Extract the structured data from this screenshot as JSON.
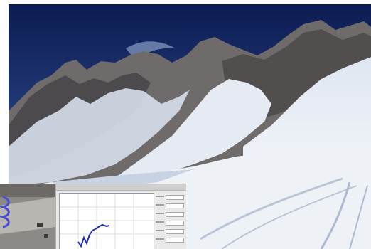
{
  "scene": {
    "description_visible_text": "",
    "colors": {
      "sky_top": "#0c1c52",
      "sky_bottom": "#3f5ea6",
      "rock_dark": "#4a4a4e",
      "rock_mid": "#7d7a78",
      "snow": "#eef2f7",
      "snow_shadow": "#c7d2e2"
    }
  },
  "inset": {
    "window_title": "",
    "plot_line_color": "#1f2fb0",
    "thumb_colors": {
      "ground": "#8b8a86",
      "track": "#4a4fd0"
    }
  }
}
